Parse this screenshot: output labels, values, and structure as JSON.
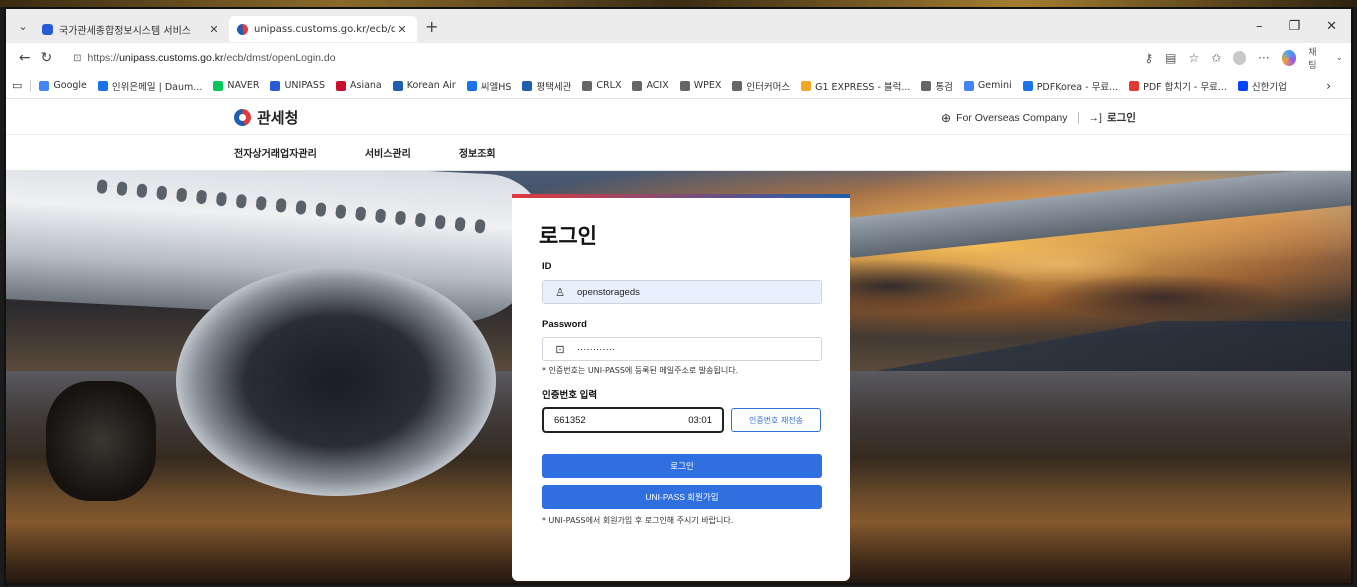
{
  "browser": {
    "tabs": [
      {
        "title": "국가관세종합정보시스템 서비스",
        "active": false,
        "favicon_color": "#2a5bd7"
      },
      {
        "title": "unipass.customs.go.kr/ecb/dmst/c",
        "active": true,
        "favicon_color": "#1d5fb0"
      }
    ],
    "address": {
      "url_prefix": "https://",
      "url_host": "unipass.customs.go.kr",
      "url_path": "/ecb/dmst/openLogin.do"
    },
    "profile_label": "채팅",
    "bookmarks": [
      {
        "label": "Google",
        "color": "#4285f4"
      },
      {
        "label": "인위은메일 | Daum...",
        "color": "#1a73e8"
      },
      {
        "label": "NAVER",
        "color": "#03c75a"
      },
      {
        "label": "UNIPASS",
        "color": "#2a5bd7"
      },
      {
        "label": "Asiana",
        "color": "#c8102e"
      },
      {
        "label": "Korean Air",
        "color": "#1d5fb0"
      },
      {
        "label": "씨엘HS",
        "color": "#1a73e8"
      },
      {
        "label": "평택세관",
        "color": "#1d5fb0"
      },
      {
        "label": "CRLX",
        "color": "#666666"
      },
      {
        "label": "ACIX",
        "color": "#666666"
      },
      {
        "label": "WPEX",
        "color": "#666666"
      },
      {
        "label": "인터커머스",
        "color": "#666666"
      },
      {
        "label": "G1 EXPRESS - 블럭...",
        "color": "#f5a623"
      },
      {
        "label": "통검",
        "color": "#666666"
      },
      {
        "label": "Gemini",
        "color": "#4285f4"
      },
      {
        "label": "PDFKorea - 무료...",
        "color": "#1a73e8"
      },
      {
        "label": "PDF 합치기 - 무료...",
        "color": "#e53935"
      },
      {
        "label": "신한기업",
        "color": "#0046ff"
      }
    ]
  },
  "site": {
    "logo_text": "관세청",
    "overseas_link": "For Overseas Company",
    "login_link": "로그인",
    "menu": [
      "전자상거래업자관리",
      "서비스관리",
      "정보조회"
    ]
  },
  "login": {
    "title": "로그인",
    "id_label": "ID",
    "id_value": "openstorageds",
    "pw_label": "Password",
    "pw_value": "············",
    "pw_note": "* 인증번호는 UNI-PASS에 등록된 메일주소로 발송됩니다.",
    "auth_label": "인증번호 입력",
    "auth_value": "661352",
    "auth_timer": "03:01",
    "resend_label": "인증번호 재전송",
    "login_button": "로그인",
    "join_button": "UNI-PASS 회원가입",
    "join_note": "* UNI-PASS에서 회원가입 후 로그인해 주시기 바랍니다."
  },
  "colors": {
    "primary_button": "#2f6fe0",
    "id_field_bg": "#e8f0fe",
    "logo_red": "#e03a3e",
    "logo_blue": "#1d5fb0"
  }
}
